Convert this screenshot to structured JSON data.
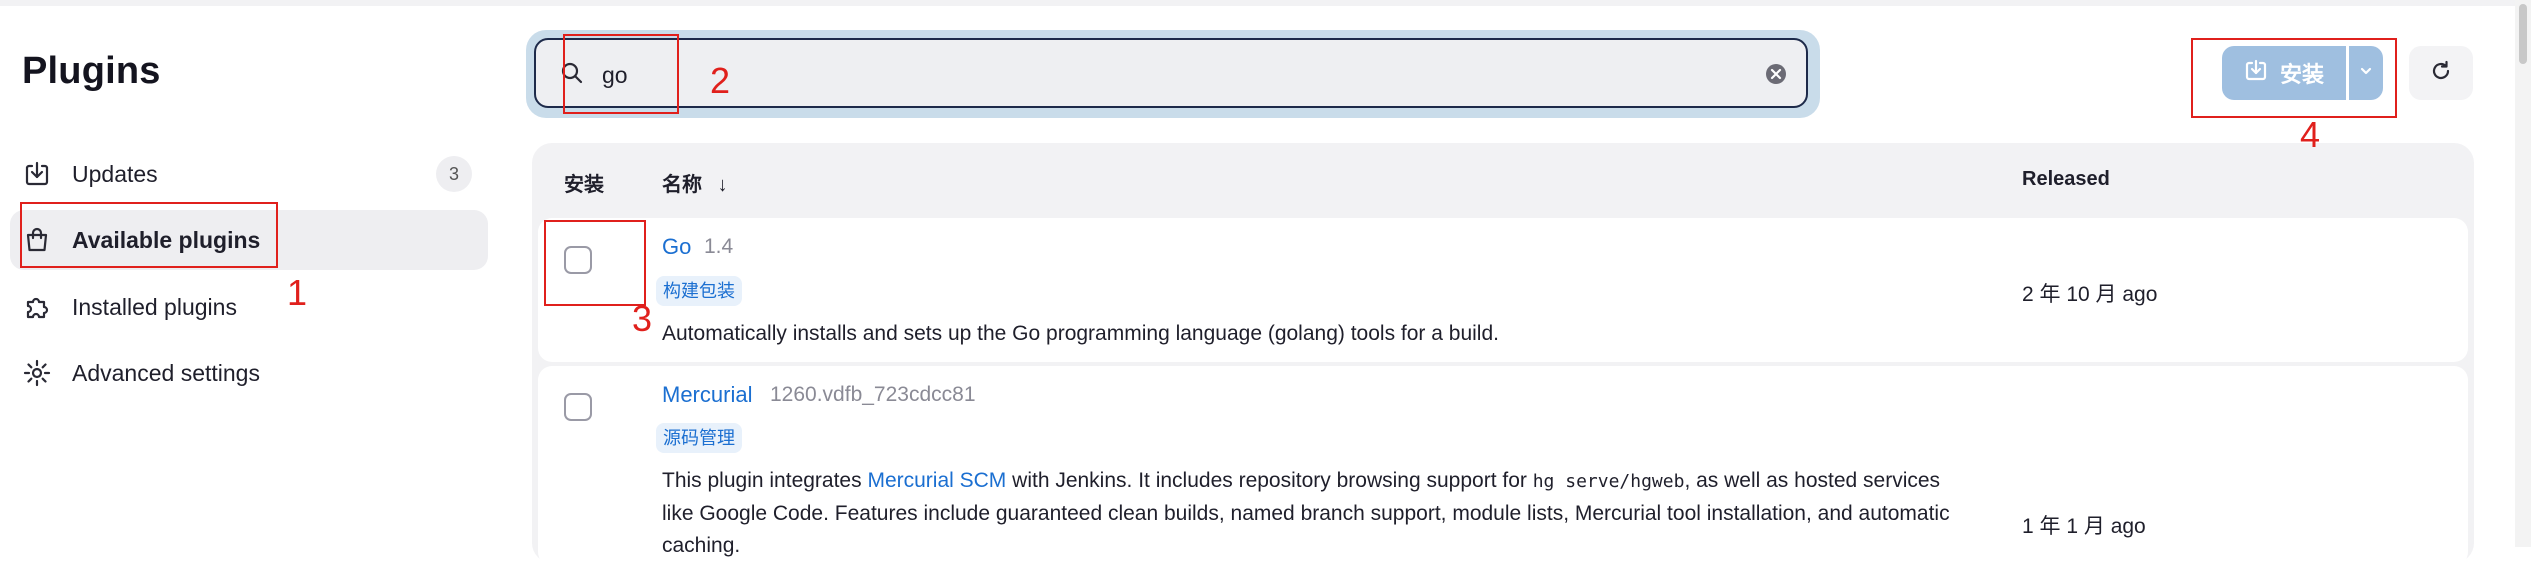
{
  "sidebar": {
    "title": "Plugins",
    "items": [
      {
        "label": "Updates",
        "icon": "download-icon",
        "badge": "3"
      },
      {
        "label": "Available plugins",
        "icon": "shopping-bag-icon"
      },
      {
        "label": "Installed plugins",
        "icon": "puzzle-icon"
      },
      {
        "label": "Advanced settings",
        "icon": "gear-icon"
      }
    ]
  },
  "search": {
    "value": "go",
    "icon": "search-icon",
    "clear_icon": "clear-icon"
  },
  "toolbar": {
    "install_label": "安装",
    "install_icon": "download-icon",
    "dropdown_icon": "chevron-down-icon",
    "refresh_icon": "refresh-icon"
  },
  "table": {
    "headers": {
      "install": "安装",
      "name": "名称",
      "sort_arrow": "↓",
      "released": "Released"
    },
    "rows": [
      {
        "name": "Go",
        "version": "1.4",
        "tag": "构建包装",
        "description": "Automatically installs and sets up the Go programming language (golang) tools for a build.",
        "released": "2 年 10 月 ago"
      },
      {
        "name": "Mercurial",
        "version": "1260.vdfb_723cdcc81",
        "tag": "源码管理",
        "desc_part1": "This plugin integrates ",
        "desc_link": "Mercurial SCM",
        "desc_part2": " with Jenkins. It includes repository browsing support for ",
        "desc_code": "hg serve/hgweb",
        "desc_part3": ", as well as hosted services like Google Code. Features include guaranteed clean builds, named branch support, module lists, Mercurial tool installation, and automatic caching.",
        "released": "1 年 1 月 ago"
      }
    ]
  },
  "annotations": [
    "1",
    "2",
    "3",
    "4"
  ],
  "colors": {
    "accent": "#1b6fd1",
    "install_button": "#9fbfe0",
    "annotation": "#e0201c"
  }
}
